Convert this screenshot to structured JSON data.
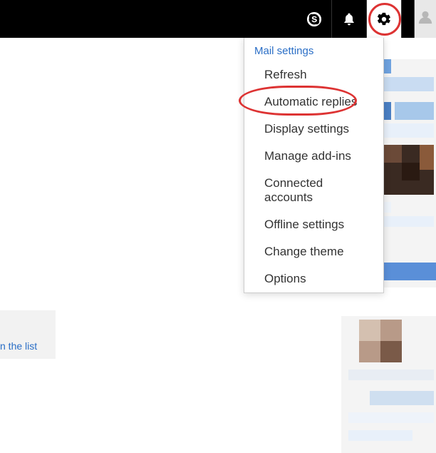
{
  "topbar": {
    "icons": {
      "skype": "skype-icon",
      "notifications": "bell-icon",
      "settings": "gear-icon",
      "help": "question-icon",
      "account": "person-icon"
    }
  },
  "menu": {
    "header": "Mail settings",
    "items": [
      {
        "label": "Refresh"
      },
      {
        "label": "Automatic replies",
        "highlighted": true
      },
      {
        "label": "Display settings"
      },
      {
        "label": "Manage add-ins"
      },
      {
        "label": "Connected accounts"
      },
      {
        "label": "Offline settings"
      },
      {
        "label": "Change theme"
      },
      {
        "label": "Options"
      }
    ]
  },
  "placeholder": {
    "text": "n the list"
  }
}
